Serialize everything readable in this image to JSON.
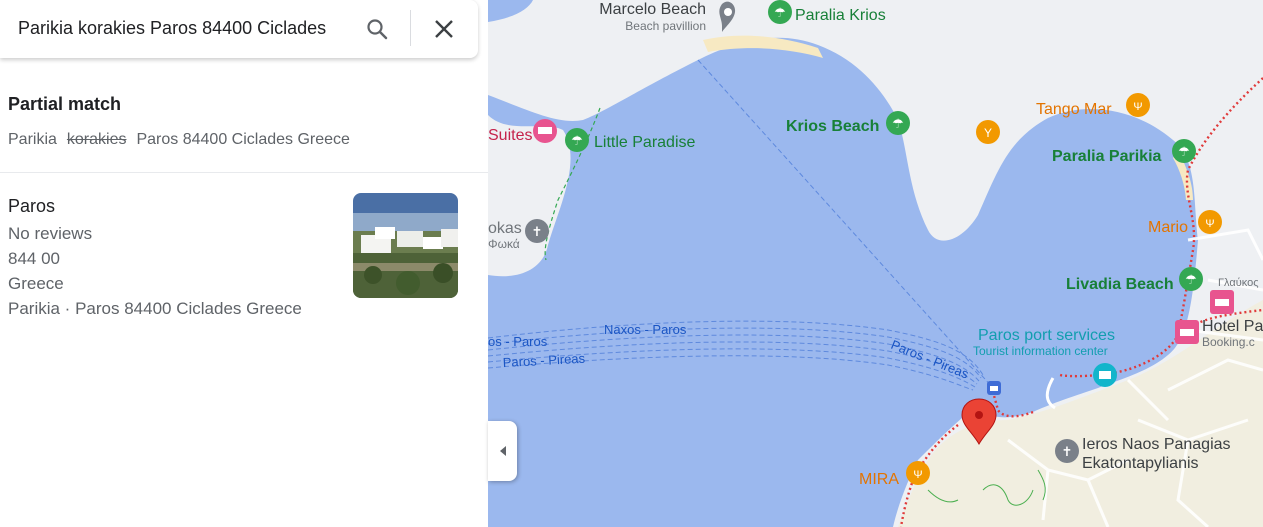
{
  "search": {
    "query": "Parikia korakies Paros 84400 Ciclades"
  },
  "partial_match": {
    "title": "Partial match",
    "matched_1": "Parikia",
    "unmatched": "korakies",
    "matched_2": "Paros 84400 Ciclades Greece"
  },
  "result": {
    "name": "Paros",
    "reviews": "No reviews",
    "postcode": "844 00",
    "country": "Greece",
    "address": "Parikia · Paros 84400 Ciclades Greece"
  },
  "map": {
    "colors": {
      "water": "#a6c1f1",
      "water_dark": "#9bb8ee",
      "land": "#eef0f3",
      "green_poi": "#34a853",
      "pink_poi": "#e8548f",
      "orange_poi": "#f29900",
      "red_pin": "#ea4335",
      "route": "#3f6cd6"
    },
    "labels": {
      "marcelo_beach": "Marcelo Beach",
      "beach_pavillion": "Beach pavillion",
      "paralia_krios": "Paralia Krios",
      "krios_beach": "Krios Beach",
      "tango_mar": "Tango Mar",
      "paralia_parikia": "Paralia Parikia",
      "suites": "Suites",
      "little_paradise": "Little Paradise",
      "okas": "okas",
      "okas_gr": "Φωκά",
      "mario": "Mario",
      "glafkos": "Γλαύκος",
      "livadia_beach": "Livadia Beach",
      "hotel_pa": "Hotel Pa",
      "booking": "Booking.c",
      "paros_port": "Paros port services",
      "tourist_info": "Tourist information center",
      "naxos_paros": "Naxos - Paros",
      "s_paros": "os - Paros",
      "paros_pireas_1": "Paros - Pireas",
      "paros_pireas_2": "Paros - Pireas",
      "ieros_naos_1": "Ieros Naos Panagias",
      "ieros_naos_2": "Ekatontapylianis",
      "mira": "MIRA",
      "top_partial": "\""
    }
  }
}
